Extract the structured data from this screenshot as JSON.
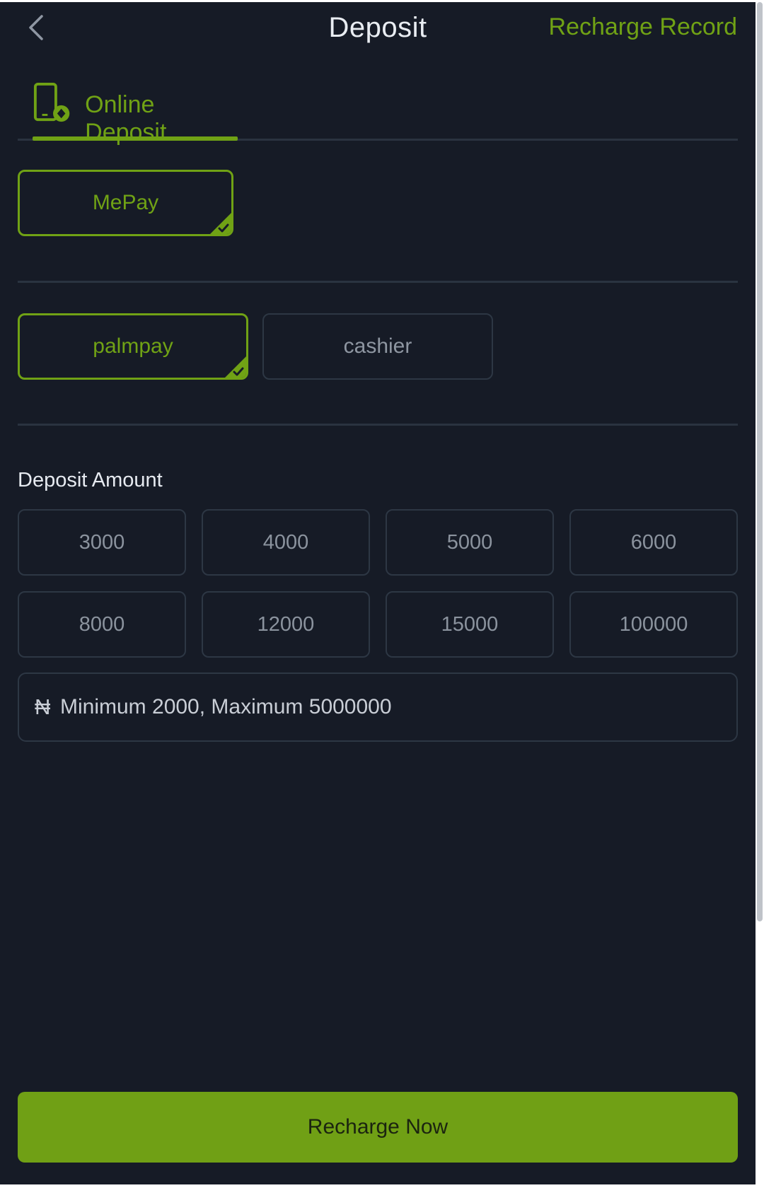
{
  "header": {
    "title": "Deposit",
    "record_link": "Recharge Record"
  },
  "tabs": [
    {
      "label": "Online Deposit",
      "icon": "phone-payment-icon",
      "active": true
    }
  ],
  "providers": [
    {
      "label": "MePay",
      "selected": true
    }
  ],
  "channels": [
    {
      "label": "palmpay",
      "selected": true
    },
    {
      "label": "cashier",
      "selected": false
    }
  ],
  "amount_section": {
    "label": "Deposit Amount",
    "presets": [
      "3000",
      "4000",
      "5000",
      "6000",
      "8000",
      "12000",
      "15000",
      "100000"
    ],
    "currency_symbol": "₦",
    "placeholder": "Minimum 2000, Maximum 5000000",
    "value": ""
  },
  "submit_label": "Recharge Now",
  "colors": {
    "background": "#161b26",
    "accent": "#70a215",
    "border": "#2d3744"
  }
}
